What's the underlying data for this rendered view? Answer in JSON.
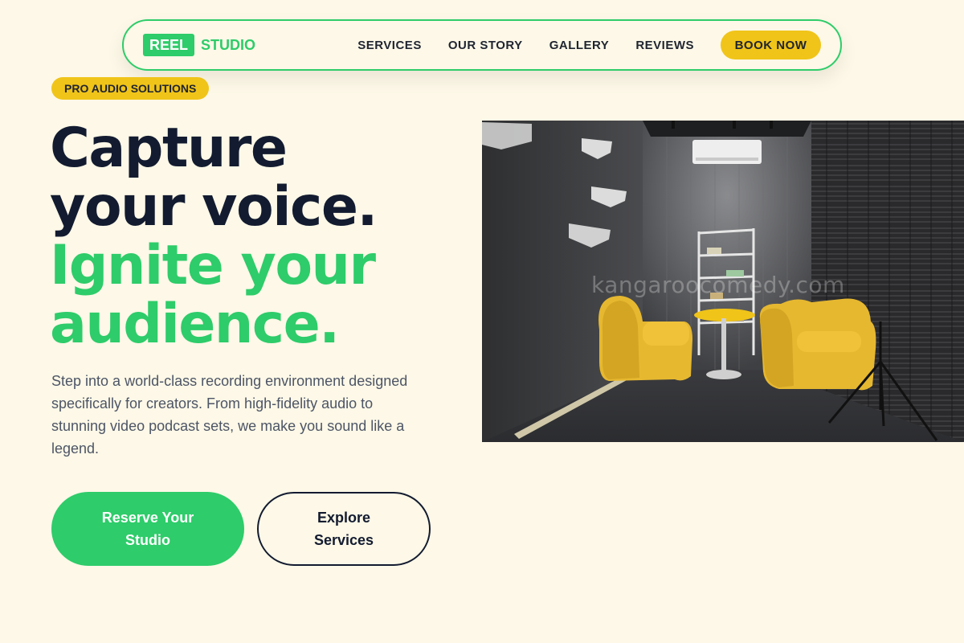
{
  "nav": {
    "logo_box": "REEL",
    "logo_text": "STUDIO",
    "links": [
      "SERVICES",
      "OUR STORY",
      "GALLERY",
      "REVIEWS"
    ],
    "cta": "BOOK NOW"
  },
  "hero": {
    "badge": "PRO AUDIO SOLUTIONS",
    "headline_dark_1": "Capture",
    "headline_dark_2": "your voice.",
    "headline_green_1": "Ignite your",
    "headline_green_2": "audience.",
    "description": "Step into a world-class recording environment designed specifically for creators. From high-fidelity audio to stunning video podcast sets, we make you sound like a legend.",
    "primary_button": "Reserve Your Studio",
    "secondary_button": "Explore Services"
  },
  "photo": {
    "watermark": "kangaroocomedy.com"
  },
  "colors": {
    "background": "#fdf8e7",
    "accent_green": "#2ecc6a",
    "accent_yellow": "#f0c419",
    "dark_text": "#131b30"
  }
}
